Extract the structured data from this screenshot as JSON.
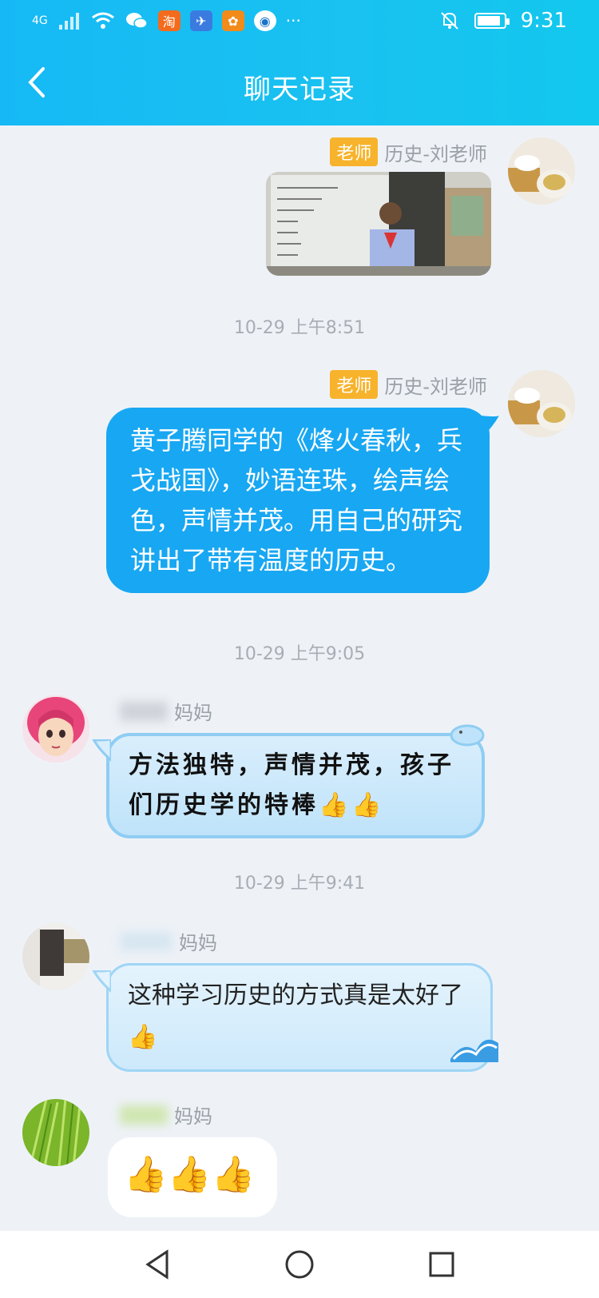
{
  "status_bar": {
    "network": "4G",
    "time": "9:31",
    "app_badge_taobao": "淘",
    "more_dots": "···"
  },
  "header": {
    "title": "聊天记录"
  },
  "messages": [
    {
      "sender_tag": "老师",
      "sender_name": "历史-刘老师",
      "type": "image"
    },
    {
      "timestamp": "10-29 上午8:51",
      "sender_tag": "老师",
      "sender_name": "历史-刘老师",
      "text": "黄子腾同学的《烽火春秋，兵戈战国》，妙语连珠，绘声绘色，声情并茂。用自己的研究讲出了带有温度的历史。"
    },
    {
      "timestamp": "10-29 上午9:05",
      "sender_name": "妈妈",
      "text": "方法独特，声情并茂，孩子们历史学的特棒👍👍"
    },
    {
      "timestamp": "10-29 上午9:41",
      "sender_name": "妈妈",
      "text": "这种学习历史的方式真是太好了👍"
    },
    {
      "sender_name": "妈妈",
      "text": "👍👍👍"
    }
  ],
  "colors": {
    "header": "#16b9f5",
    "bubble_blue": "#18a7f2",
    "tag": "#f7b32b"
  }
}
